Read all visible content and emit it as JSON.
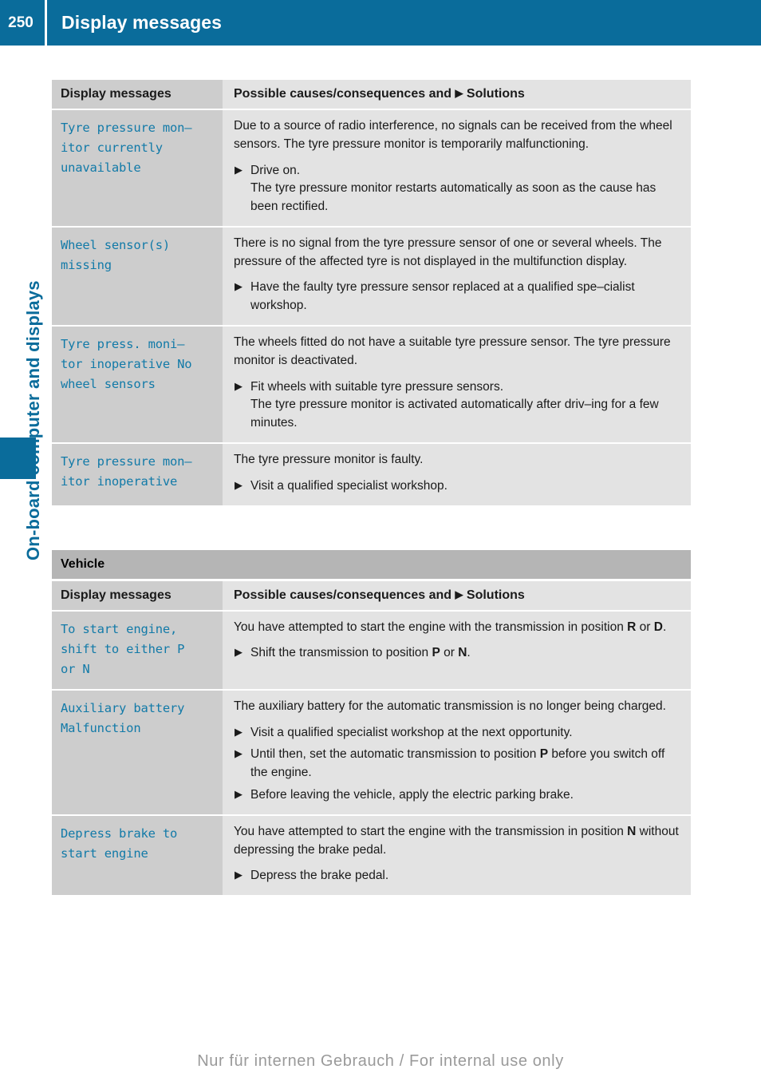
{
  "header": {
    "page_number": "250",
    "title": "Display messages"
  },
  "sidebar": {
    "chapter_label": "On-board computer and displays"
  },
  "columns": {
    "left_header": "Display messages",
    "right_header_before_arrow": "Possible causes/consequences and ",
    "arrow_glyph": "▶",
    "right_header_after_arrow": " Solutions"
  },
  "tables": [
    {
      "section_title": null,
      "rows": [
        {
          "message": "Tyre pressure mon–\nitor currently\nunavailable",
          "cause": "Due to a source of radio interference, no signals can be received from the wheel sensors. The tyre pressure monitor is temporarily malfunctioning.",
          "solutions": [
            {
              "text": "Drive on.",
              "sub": "The tyre pressure monitor restarts automatically as soon as the cause has been rectified."
            }
          ]
        },
        {
          "message": "Wheel sensor(s)\nmissing",
          "cause": "There is no signal from the tyre pressure sensor of one or several wheels. The pressure of the affected tyre is not displayed in the multifunction display.",
          "solutions": [
            {
              "text": "Have the faulty tyre pressure sensor replaced at a qualified spe–cialist workshop.",
              "sub": null
            }
          ]
        },
        {
          "message": "Tyre press. moni–\ntor inoperative No\nwheel sensors",
          "cause": "The wheels fitted do not have a suitable tyre pressure sensor. The tyre pressure monitor is deactivated.",
          "solutions": [
            {
              "text": "Fit wheels with suitable tyre pressure sensors.",
              "sub": "The tyre pressure monitor is activated automatically after driv–ing for a few minutes."
            }
          ]
        },
        {
          "message": "Tyre pressure mon–\nitor inoperative",
          "cause": "The tyre pressure monitor is faulty.",
          "solutions": [
            {
              "text": "Visit a qualified specialist workshop.",
              "sub": null
            }
          ]
        }
      ]
    },
    {
      "section_title": "Vehicle",
      "rows": [
        {
          "message": "To start engine,\nshift to either P\nor N",
          "cause_html": "You have attempted to start the engine with the transmission in position <b>R</b> or <b>D</b>.",
          "solutions": [
            {
              "html": "Shift the transmission to position <b>P</b> or <b>N</b>.",
              "sub": null
            }
          ]
        },
        {
          "message": "Auxiliary battery\nMalfunction",
          "cause_html": "The auxiliary battery for the automatic transmission is no longer being charged.",
          "solutions": [
            {
              "html": "Visit a qualified specialist workshop at the next opportunity.",
              "sub": null
            },
            {
              "html": "Until then, set the automatic transmission to position <b>P</b> before you switch off the engine.",
              "sub": null
            },
            {
              "html": "Before leaving the vehicle, apply the electric parking brake.",
              "sub": null
            }
          ]
        },
        {
          "message": "Depress brake to\nstart engine",
          "cause_html": "You have attempted to start the engine with the transmission in position <b>N</b> without depressing the brake pedal.",
          "solutions": [
            {
              "html": "Depress the brake pedal.",
              "sub": null
            }
          ]
        }
      ]
    }
  ],
  "footer": {
    "watermark": "Nur für internen Gebrauch / For internal use only"
  },
  "colors": {
    "brand_blue": "#0a6c9b",
    "message_blue": "#127aa8",
    "section_header_gray": "#b5b5b5",
    "left_cell_gray": "#cdcdcd",
    "right_cell_gray": "#e3e3e3",
    "watermark_gray": "#9a9a9a"
  }
}
